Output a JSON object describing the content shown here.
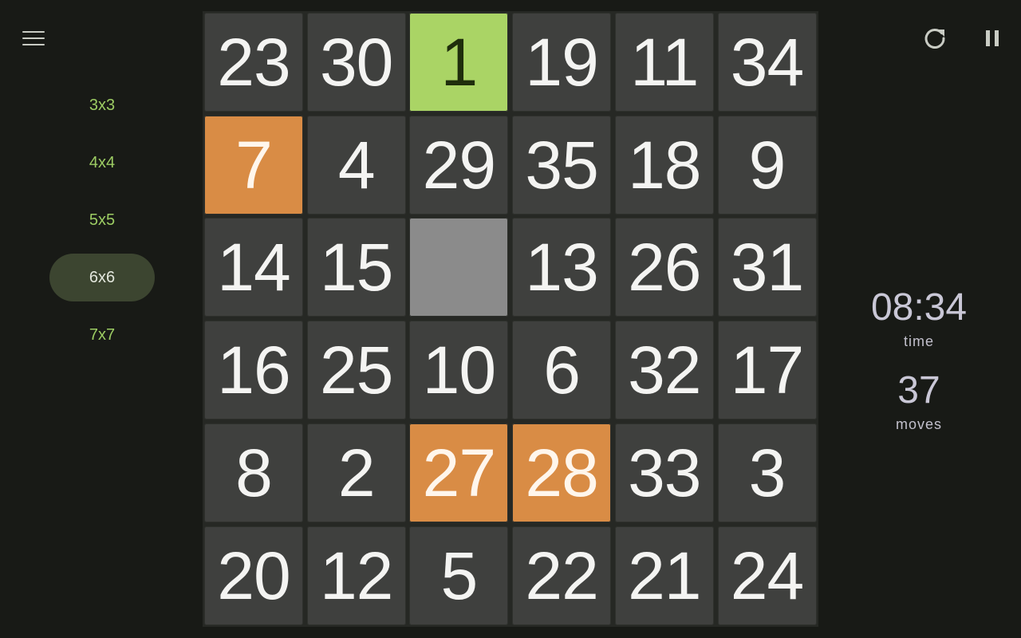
{
  "menu": {
    "icon": "hamburger-menu-icon"
  },
  "sizes": [
    {
      "label": "3x3",
      "selected": false
    },
    {
      "label": "4x4",
      "selected": false
    },
    {
      "label": "5x5",
      "selected": false
    },
    {
      "label": "6x6",
      "selected": true
    },
    {
      "label": "7x7",
      "selected": false
    }
  ],
  "board": {
    "columns": 6,
    "rows": [
      [
        {
          "n": "23"
        },
        {
          "n": "30"
        },
        {
          "n": "1",
          "state": "placed"
        },
        {
          "n": "19"
        },
        {
          "n": "11"
        },
        {
          "n": "34"
        }
      ],
      [
        {
          "n": "7",
          "state": "movable"
        },
        {
          "n": "4"
        },
        {
          "n": "29"
        },
        {
          "n": "35"
        },
        {
          "n": "18"
        },
        {
          "n": "9"
        }
      ],
      [
        {
          "n": "14"
        },
        {
          "n": "15"
        },
        {
          "n": "",
          "state": "empty"
        },
        {
          "n": "13"
        },
        {
          "n": "26"
        },
        {
          "n": "31"
        }
      ],
      [
        {
          "n": "16"
        },
        {
          "n": "25"
        },
        {
          "n": "10"
        },
        {
          "n": "6"
        },
        {
          "n": "32"
        },
        {
          "n": "17"
        }
      ],
      [
        {
          "n": "8"
        },
        {
          "n": "2"
        },
        {
          "n": "27",
          "state": "movable"
        },
        {
          "n": "28",
          "state": "movable"
        },
        {
          "n": "33"
        },
        {
          "n": "3"
        }
      ],
      [
        {
          "n": "20"
        },
        {
          "n": "12"
        },
        {
          "n": "5"
        },
        {
          "n": "22"
        },
        {
          "n": "21"
        },
        {
          "n": "24"
        }
      ]
    ]
  },
  "controls": {
    "restart_icon": "restart-icon",
    "pause_icon": "pause-icon"
  },
  "stats": {
    "time_value": "08:34",
    "time_label": "time",
    "moves_value": "37",
    "moves_label": "moves"
  },
  "colors": {
    "background": "#181a16",
    "tile": "#3f403e",
    "placed": "#aad465",
    "movable": "#d98c45",
    "empty": "#8b8b8b",
    "accent": "#9ccc63"
  }
}
